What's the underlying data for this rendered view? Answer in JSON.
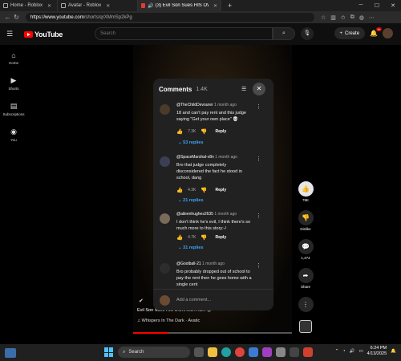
{
  "browser": {
    "tabs": [
      {
        "label": "Home - Roblox",
        "active": false
      },
      {
        "label": "Avatar - Roblox",
        "active": false
      },
      {
        "label": "(3) Evil Son Sues HIS OWN M",
        "active": true
      }
    ],
    "new_tab": "+",
    "url_host": "https://www.youtube.com",
    "url_path": "/shorts/qrXMmSp2kPg"
  },
  "youtube": {
    "logo_text": "YouTube",
    "search_placeholder": "Search",
    "create_label": "Create",
    "notification_count": "9+",
    "sidebar": [
      {
        "icon": "home-icon",
        "glyph": "⌂",
        "label": "Home"
      },
      {
        "icon": "shorts-icon",
        "glyph": "▶",
        "label": "Shorts"
      },
      {
        "icon": "subscriptions-icon",
        "glyph": "▤",
        "label": "Subscriptions"
      },
      {
        "icon": "you-icon",
        "glyph": "◉",
        "label": "You"
      }
    ]
  },
  "video": {
    "title": "Evil Son Sues HIS OWN MOTHER 😡",
    "music": "♫ Whispers In The Dark · Avatic",
    "progress": 0.22
  },
  "actions": {
    "likes": "78K",
    "dislike": "Dislike",
    "comments": "1,474",
    "share": "Share"
  },
  "comments_panel": {
    "title": "Comments",
    "count": "1.4K",
    "add_placeholder": "Add a comment...",
    "items": [
      {
        "author": "@TheChildDevourer",
        "time": "1 month ago",
        "text": "18 and can't pay rent and this judge saying \"Get your own place\" 💀",
        "likes": "7.3K",
        "reply_label": "Reply",
        "replies": "53 replies"
      },
      {
        "author": "@SpaceMarshal-v8n",
        "time": "1 month ago",
        "text": "Bro that judge completely disconsidered the fact he stood in school, dang",
        "likes": "4.3K",
        "reply_label": "Reply",
        "replies": "21 replies"
      },
      {
        "author": "@aileenhughes2635",
        "time": "1 month ago",
        "text": "I don't think he's evil, I think there's so much more to this story:-/",
        "likes": "4.7K",
        "reply_label": "Reply",
        "replies": "31 replies"
      },
      {
        "author": "@Goolball-21",
        "time": "1 month ago",
        "text": "Bro probably dropped out of school to pay the rent then he goes home with a single cent",
        "likes": "",
        "reply_label": "",
        "replies": ""
      }
    ]
  },
  "taskbar": {
    "search_label": "Search",
    "time": "6:24 PM",
    "date": "4/13/2025"
  }
}
